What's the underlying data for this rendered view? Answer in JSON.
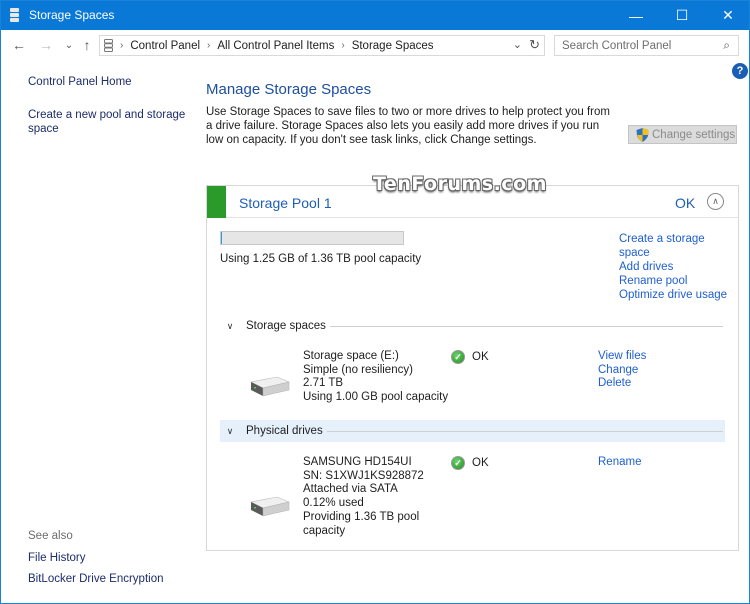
{
  "window": {
    "title": "Storage Spaces",
    "controls": {
      "minimize": "—",
      "maximize": "☐",
      "close": "✕"
    }
  },
  "nav": {
    "back": "←",
    "forward": "→",
    "recent": "⌄",
    "up": "↑",
    "breadcrumb": [
      "Control Panel",
      "All Control Panel Items",
      "Storage Spaces"
    ],
    "dropdown": "⌄",
    "refresh": "↻",
    "search_placeholder": "Search Control Panel",
    "search_icon": "⌕"
  },
  "sidebar": {
    "items": [
      {
        "label": "Control Panel Home"
      },
      {
        "label": "Create a new pool and storage space"
      }
    ],
    "see_also_label": "See also",
    "see_also": [
      {
        "label": "File History"
      },
      {
        "label": "BitLocker Drive Encryption"
      }
    ]
  },
  "help": {
    "label": "?"
  },
  "main": {
    "heading": "Manage Storage Spaces",
    "description": "Use Storage Spaces to save files to two or more drives to help protect you from a drive failure. Storage Spaces also lets you easily add more drives if you run low on capacity. If you don't see task links, click Change settings.",
    "change_settings": "Change settings"
  },
  "watermark": "TenForums.com",
  "pool": {
    "name": "Storage Pool 1",
    "status": "OK",
    "accent_color": "#2a9a2a",
    "usage_fraction": 0.0009,
    "usage_text": "Using 1.25 GB of 1.36 TB pool capacity",
    "tasks": [
      {
        "label": "Create a storage space"
      },
      {
        "label": "Add drives"
      },
      {
        "label": "Rename pool"
      },
      {
        "label": "Optimize drive usage"
      }
    ],
    "storage_spaces": {
      "label": "Storage spaces",
      "items": [
        {
          "lines": [
            "Storage space (E:)",
            "Simple (no resiliency)",
            "2.71 TB",
            "Using 1.00 GB pool capacity"
          ],
          "status": "OK",
          "actions": [
            "View files",
            "Change",
            "Delete"
          ]
        }
      ]
    },
    "physical_drives": {
      "label": "Physical drives",
      "items": [
        {
          "lines": [
            "SAMSUNG HD154UI",
            "SN: S1XWJ1KS928872",
            "Attached via SATA",
            "0.12% used",
            "Providing 1.36 TB pool",
            "capacity"
          ],
          "status": "OK",
          "actions": [
            "Rename"
          ]
        }
      ]
    }
  }
}
